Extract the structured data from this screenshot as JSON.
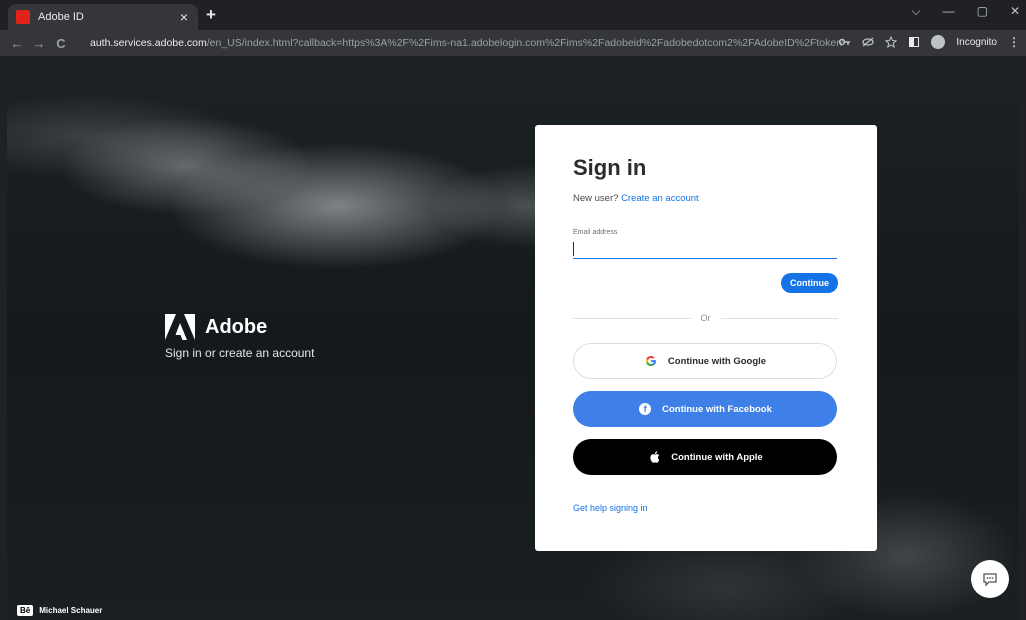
{
  "browser": {
    "tab_title": "Adobe ID",
    "tab_close": "×",
    "new_tab": "+",
    "back": "←",
    "forward": "→",
    "reload": "C",
    "url_domain": "auth.services.adobe.com",
    "url_rest": "/en_US/index.html?callback=https%3A%2F%2Fims-na1.adobelogin.com%2Fims%2Fadobeid%2Fadobedotcom2%2FAdobeID%2Ftoken%3Fredirect_uri%3Dh...",
    "incognito_label": "Incognito",
    "minimize": "—",
    "restore": "▢",
    "close": "✕",
    "chevron": "⌵",
    "menu": "⋮"
  },
  "brand": {
    "name": "Adobe",
    "subtitle": "Sign in or create an account"
  },
  "credit": {
    "badge": "Bē",
    "name": "Michael Schauer"
  },
  "signin": {
    "title": "Sign in",
    "new_user_prefix": "New user?",
    "create_account": "Create an account",
    "email_label": "Email address",
    "email_value": "",
    "continue": "Continue",
    "or": "Or",
    "google": "Continue with Google",
    "facebook": "Continue with Facebook",
    "apple": "Continue with Apple",
    "help": "Get help signing in"
  },
  "colors": {
    "accent": "#1473e6",
    "facebook": "#3e7fe8",
    "apple": "#000000"
  }
}
